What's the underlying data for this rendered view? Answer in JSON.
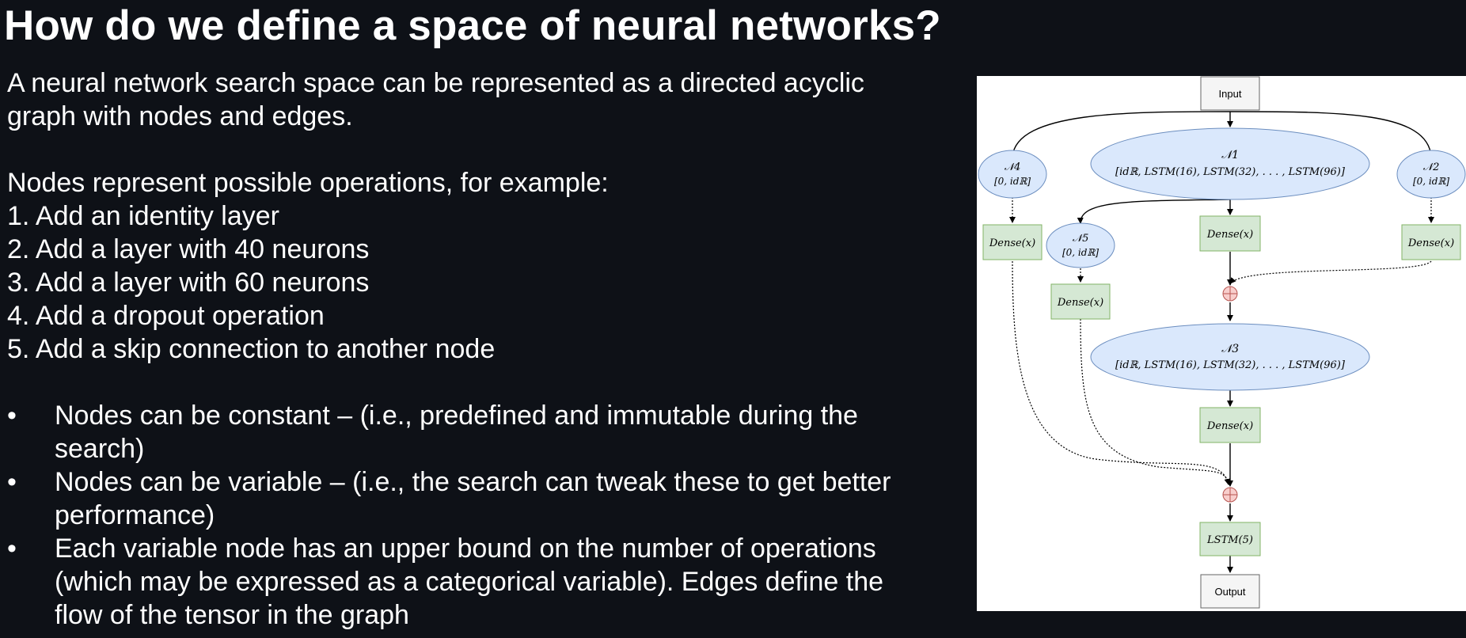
{
  "slide": {
    "title": "How do we define a space of neural networks?",
    "intro_line1": "A neural network search space can be represented as a directed acyclic",
    "intro_line2": "graph with nodes and edges.",
    "nodes_intro": "Nodes represent possible operations, for example:",
    "operations": [
      "1. Add an identity layer",
      "2. Add a layer with 40 neurons",
      "3. Add a layer with 60 neurons",
      "4. Add a dropout operation",
      "5. Add a skip connection to another node"
    ],
    "bullets": [
      {
        "line1": "Nodes can be constant – (i.e., predefined and immutable during the",
        "line2": "search)"
      },
      {
        "line1": "Nodes can be variable – (i.e., the search can tweak these to get better",
        "line2": "performance)"
      },
      {
        "line1": "Each variable node has an upper bound on the number of operations",
        "line2": "(which may be expressed as a categorical variable). Edges define the",
        "line3": "flow of the tensor in the graph"
      }
    ]
  },
  "diagram": {
    "input_label": "Input",
    "output_label": "Output",
    "n1_name": "𝒩1",
    "n1_ops": "[idℝ, LSTM(16), LSTM(32), . . . , LSTM(96)]",
    "n2_name": "𝒩2",
    "n2_ops": "[0, idℝ]",
    "n3_name": "𝒩3",
    "n3_ops": "[idℝ, LSTM(16), LSTM(32), . . . , LSTM(96)]",
    "n4_name": "𝒩4",
    "n4_ops": "[0, idℝ]",
    "n5_name": "𝒩5",
    "n5_ops": "[0, idℝ]",
    "dense_label": "Dense(x)",
    "lstm5_label": "LSTM(5)",
    "colors": {
      "node_fill": "#dae8fc",
      "node_stroke": "#6c8ebf",
      "box_fill": "#d5e8d4",
      "box_stroke": "#82b366",
      "add_fill": "#f8cecc",
      "add_stroke": "#b85450"
    }
  }
}
